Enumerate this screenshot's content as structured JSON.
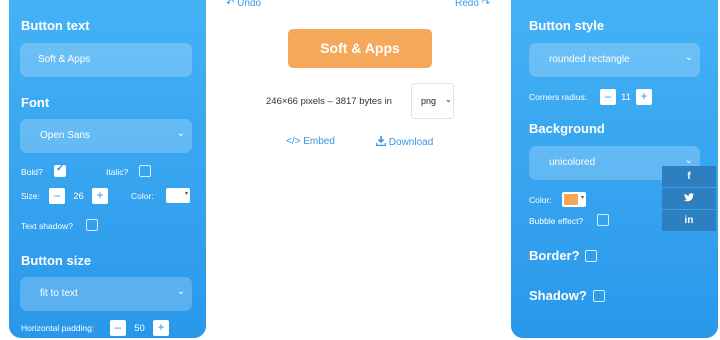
{
  "toolbar": {
    "undo_icon": "↶",
    "undo": "Undo",
    "redo": "Redo",
    "redo_icon": "↷"
  },
  "left": {
    "button_text_title": "Button text",
    "button_text_value": "Soft & Apps",
    "font_title": "Font",
    "font_value": "Open Sans",
    "bold_label": "Bold?",
    "bold_checked": true,
    "italic_label": "Italic?",
    "italic_checked": false,
    "size_label": "Size:",
    "size_value": "26",
    "color_label": "Color:",
    "color_value": "#ffffff",
    "shadow_label": "Text shadow?",
    "shadow_checked": false,
    "size_title": "Button size",
    "size_mode": "fit to text",
    "padding_label": "Horizontal padding:",
    "padding_value": "50"
  },
  "preview": {
    "button_label": "Soft & Apps",
    "button_color": "#f5a85a",
    "info": "246×66 pixels – 3817 bytes in",
    "format": "png",
    "embed": "</> Embed",
    "download": "Download"
  },
  "right": {
    "style_title": "Button style",
    "style_value": "rounded rectangle",
    "corners_label": "Corners radius:",
    "corners_value": "11",
    "background_title": "Background",
    "background_value": "unicolored",
    "bg_color_label": "Color:",
    "bg_color_value": "#f5a85a",
    "bubble_label": "Bubble effect?",
    "bubble_checked": false,
    "border_title": "Border?",
    "border_checked": false,
    "shadow_title": "Shadow?",
    "shadow_checked": false
  },
  "social": {
    "facebook": "f",
    "twitter_icon": "twitter-icon",
    "linkedin": "in"
  },
  "symbols": {
    "minus": "–",
    "plus": "+",
    "chevron": "⌄",
    "caret": "▾"
  }
}
